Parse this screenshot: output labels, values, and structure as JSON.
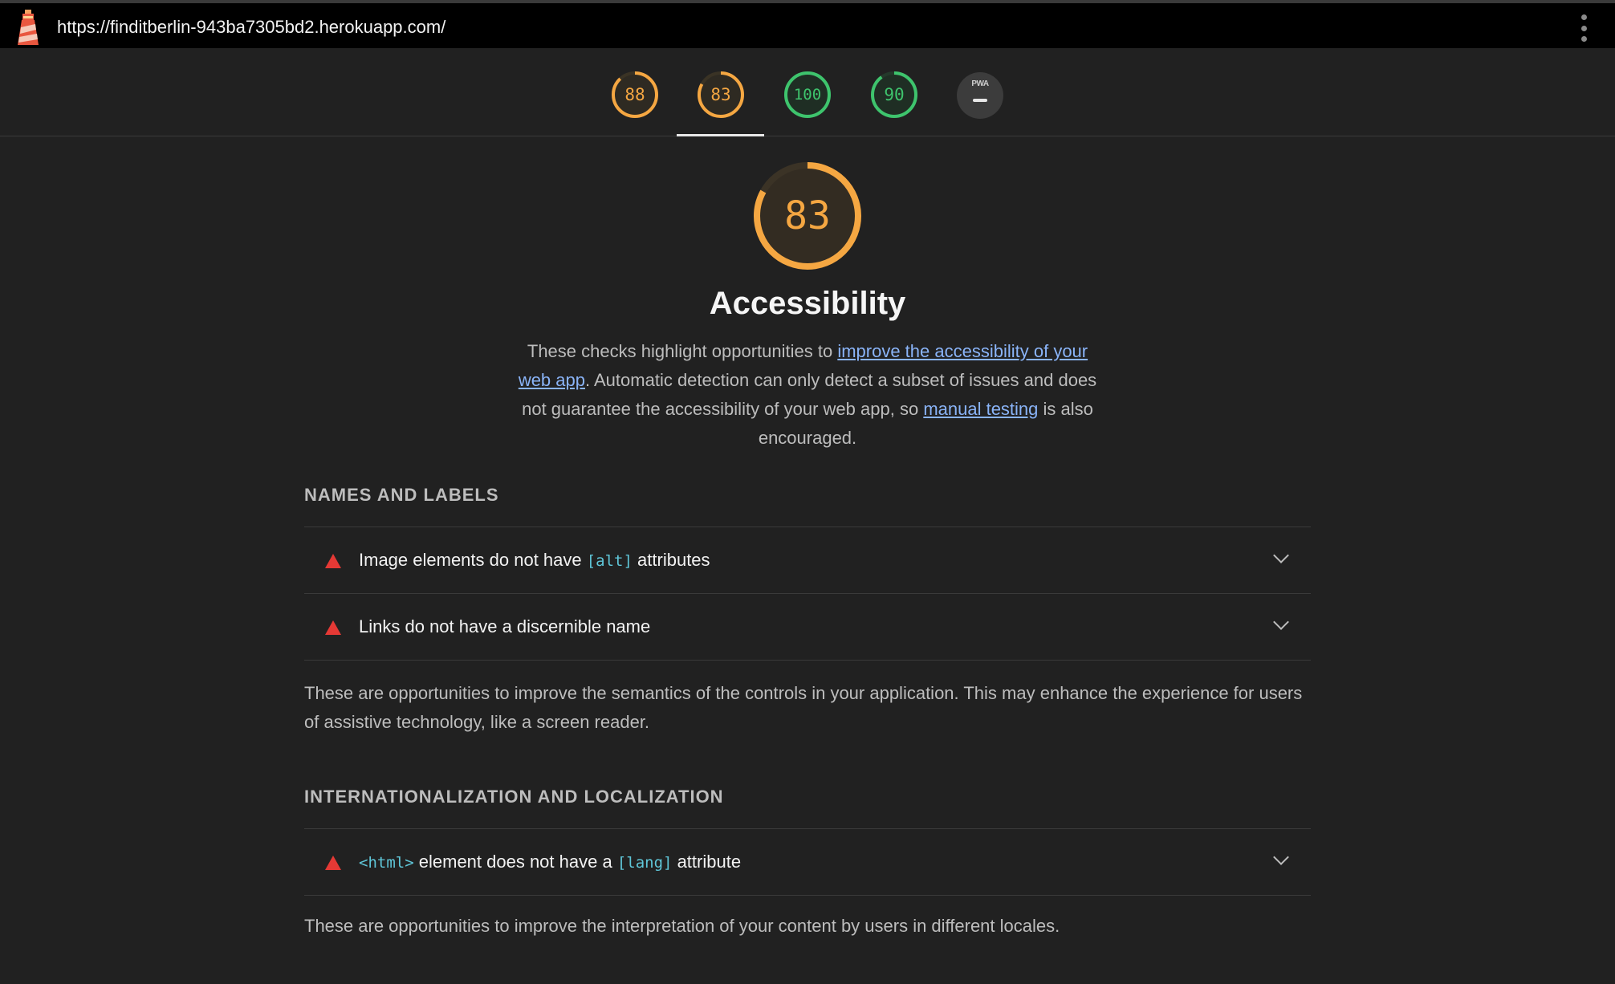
{
  "address_bar": {
    "url": "https://finditberlin-943ba7305bd2.herokuapp.com/"
  },
  "score_tabs": [
    {
      "score": "88",
      "color": "#f5a742"
    },
    {
      "score": "83",
      "color": "#f5a742"
    },
    {
      "score": "100",
      "color": "#3ec46d"
    },
    {
      "score": "90",
      "color": "#3ec46d"
    },
    {
      "score": "PWA",
      "color": "#cfcfcf"
    }
  ],
  "category": {
    "score": "83",
    "score_fraction": 0.83,
    "title": "Accessibility",
    "desc_part1": "These checks highlight opportunities to ",
    "desc_link1": "improve the accessibility of your web app",
    "desc_part2": ". Automatic detection can only detect a subset of issues and does not guarantee the accessibility of your web app, so ",
    "desc_link2": "manual testing",
    "desc_part3": " is also encouraged."
  },
  "groups": [
    {
      "title": "NAMES AND LABELS",
      "audits": [
        {
          "pre": "Image elements do not have ",
          "code": "[alt]",
          "post": " attributes"
        },
        {
          "pre": "Links do not have a discernible name",
          "code": "",
          "post": ""
        }
      ],
      "description": "These are opportunities to improve the semantics of the controls in your application. This may enhance the experience for users of assistive technology, like a screen reader."
    },
    {
      "title": "INTERNATIONALIZATION AND LOCALIZATION",
      "audits": [
        {
          "code_pre": "<html>",
          "pre": " element does not have a ",
          "code": "[lang]",
          "post": " attribute"
        }
      ],
      "description": "These are opportunities to improve the interpretation of your content by users in different locales."
    }
  ],
  "colors": {
    "average": "#f5a742",
    "pass": "#3ec46d",
    "fail": "#e53935",
    "link": "#8ab4f8"
  }
}
